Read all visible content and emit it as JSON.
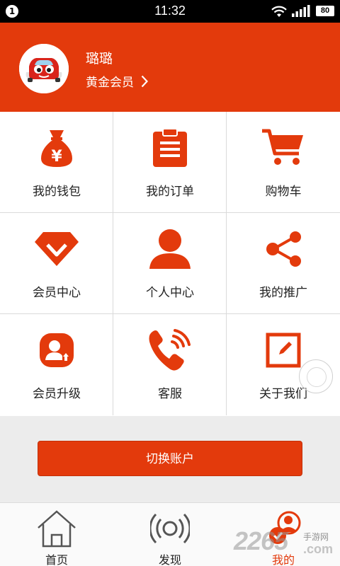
{
  "status_bar": {
    "notification_count": "1",
    "time": "11:32",
    "battery": "80"
  },
  "profile": {
    "name": "璐璐",
    "level": "黄金会员"
  },
  "menu": [
    {
      "label": "我的钱包",
      "icon": "money-bag-icon"
    },
    {
      "label": "我的订单",
      "icon": "clipboard-icon"
    },
    {
      "label": "购物车",
      "icon": "shopping-cart-icon"
    },
    {
      "label": "会员中心",
      "icon": "gem-icon"
    },
    {
      "label": "个人中心",
      "icon": "person-icon"
    },
    {
      "label": "我的推广",
      "icon": "share-icon"
    },
    {
      "label": "会员升级",
      "icon": "upgrade-icon"
    },
    {
      "label": "客服",
      "icon": "phone-icon"
    },
    {
      "label": "关于我们",
      "icon": "edit-icon"
    }
  ],
  "switch_account_label": "切换账户",
  "tabs": [
    {
      "label": "首页",
      "icon": "home-icon"
    },
    {
      "label": "发现",
      "icon": "discover-icon"
    },
    {
      "label": "我的",
      "icon": "profile-icon",
      "active": true
    }
  ],
  "watermark": {
    "number": "2265",
    "site": "手游网",
    "domain": ".com"
  },
  "colors": {
    "accent": "#e33a0c",
    "background": "#ececec"
  }
}
